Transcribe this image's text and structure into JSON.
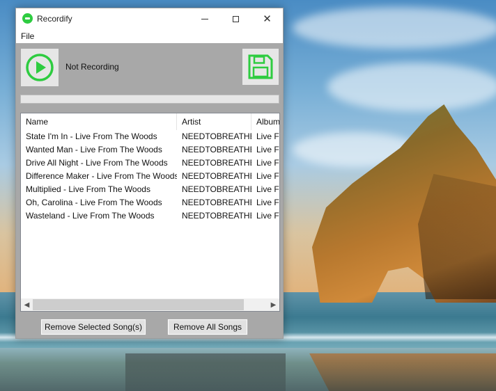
{
  "window": {
    "title": "Recordify",
    "controls": [
      "minimize",
      "maximize",
      "close"
    ]
  },
  "menu": {
    "items": [
      "File"
    ]
  },
  "recorder": {
    "status": "Not Recording",
    "record_icon": "play-circle-icon",
    "save_icon": "floppy-disk-icon",
    "progress": 0,
    "accent": "#2ecc40"
  },
  "songs": {
    "columns": [
      "Name",
      "Artist",
      "Album"
    ],
    "rows": [
      {
        "name": "State I'm In - Live From The Woods",
        "artist": "NEEDTOBREATHE",
        "album": "Live Fr"
      },
      {
        "name": "Wanted Man - Live From The Woods",
        "artist": "NEEDTOBREATHE",
        "album": "Live Fr"
      },
      {
        "name": "Drive All Night - Live From The Woods",
        "artist": "NEEDTOBREATHE",
        "album": "Live Fr"
      },
      {
        "name": "Difference Maker - Live From The Woods",
        "artist": "NEEDTOBREATHE",
        "album": "Live Fr"
      },
      {
        "name": "Multiplied - Live From The Woods",
        "artist": "NEEDTOBREATHE",
        "album": "Live Fr"
      },
      {
        "name": "Oh, Carolina - Live From The Woods",
        "artist": "NEEDTOBREATHE",
        "album": "Live Fr"
      },
      {
        "name": "Wasteland - Live From The Woods",
        "artist": "NEEDTOBREATHE",
        "album": "Live Fr"
      }
    ]
  },
  "actions": {
    "remove_selected": "Remove Selected Song(s)",
    "remove_all": "Remove All Songs"
  }
}
